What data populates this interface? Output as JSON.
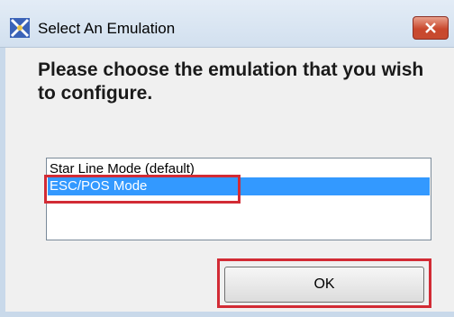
{
  "window": {
    "title": "Select An Emulation",
    "icon": "star-emulation-app-icon",
    "close_icon": "close-x-icon"
  },
  "dialog": {
    "prompt": "Please choose the emulation that you wish to configure.",
    "emulations": [
      {
        "label": "Star Line Mode (default)",
        "selected": false
      },
      {
        "label": "ESC/POS Mode",
        "selected": true
      }
    ],
    "ok_label": "OK"
  },
  "colors": {
    "highlight": "#d22b35",
    "selection": "#3399ff",
    "close_button": "#c9482d"
  }
}
